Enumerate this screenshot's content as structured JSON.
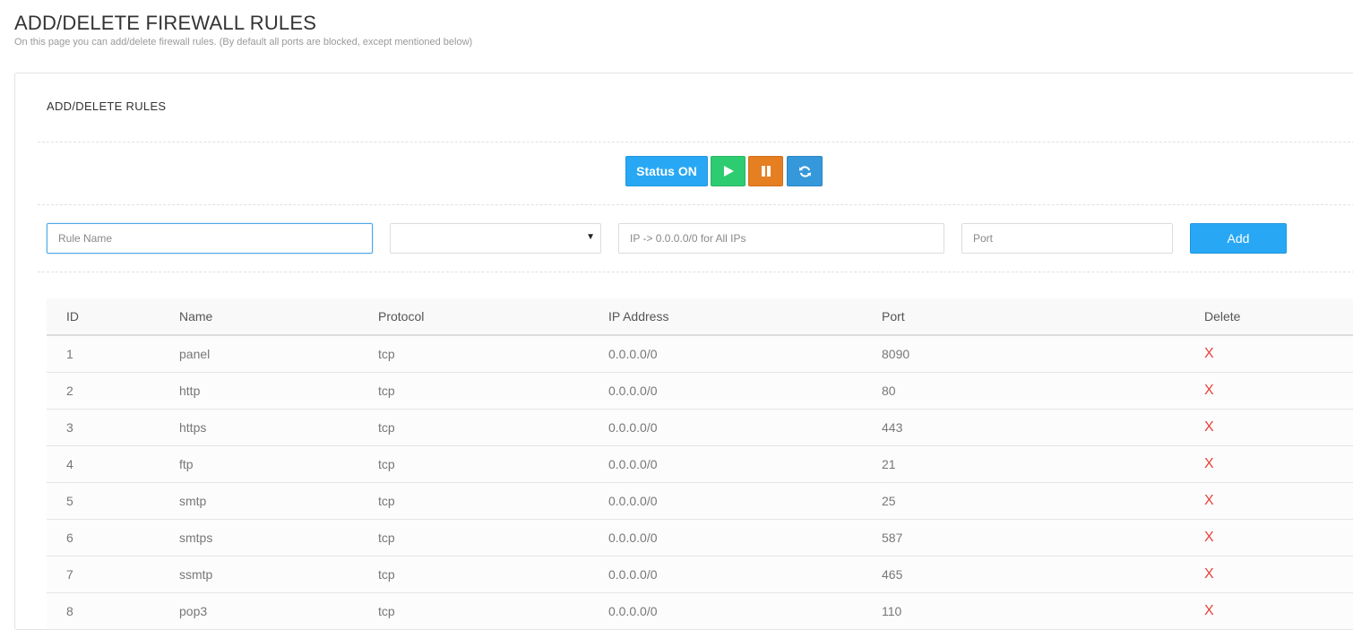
{
  "page": {
    "title": "ADD/DELETE FIREWALL RULES",
    "subtitle": "On this page you can add/delete firewall rules. (By default all ports are blocked, except mentioned below)"
  },
  "panel": {
    "title": "ADD/DELETE RULES"
  },
  "controls": {
    "status_label": "Status ON",
    "play_icon": "play-icon",
    "pause_icon": "pause-icon",
    "refresh_icon": "refresh-icon"
  },
  "form": {
    "rule_name_placeholder": "Rule Name",
    "protocol_value": "",
    "ip_placeholder": "IP -> 0.0.0.0/0 for All IPs",
    "port_placeholder": "Port",
    "add_label": "Add"
  },
  "table": {
    "headers": [
      "ID",
      "Name",
      "Protocol",
      "IP Address",
      "Port",
      "Delete"
    ],
    "delete_symbol": "X",
    "rows": [
      {
        "id": "1",
        "name": "panel",
        "protocol": "tcp",
        "ip": "0.0.0.0/0",
        "port": "8090"
      },
      {
        "id": "2",
        "name": "http",
        "protocol": "tcp",
        "ip": "0.0.0.0/0",
        "port": "80"
      },
      {
        "id": "3",
        "name": "https",
        "protocol": "tcp",
        "ip": "0.0.0.0/0",
        "port": "443"
      },
      {
        "id": "4",
        "name": "ftp",
        "protocol": "tcp",
        "ip": "0.0.0.0/0",
        "port": "21"
      },
      {
        "id": "5",
        "name": "smtp",
        "protocol": "tcp",
        "ip": "0.0.0.0/0",
        "port": "25"
      },
      {
        "id": "6",
        "name": "smtps",
        "protocol": "tcp",
        "ip": "0.0.0.0/0",
        "port": "587"
      },
      {
        "id": "7",
        "name": "ssmtp",
        "protocol": "tcp",
        "ip": "0.0.0.0/0",
        "port": "465"
      },
      {
        "id": "8",
        "name": "pop3",
        "protocol": "tcp",
        "ip": "0.0.0.0/0",
        "port": "110"
      }
    ]
  },
  "colors": {
    "primary": "#28a8f4",
    "play": "#2ecc71",
    "pause": "#e67e22",
    "refresh": "#3498db",
    "delete": "#e8403a"
  }
}
